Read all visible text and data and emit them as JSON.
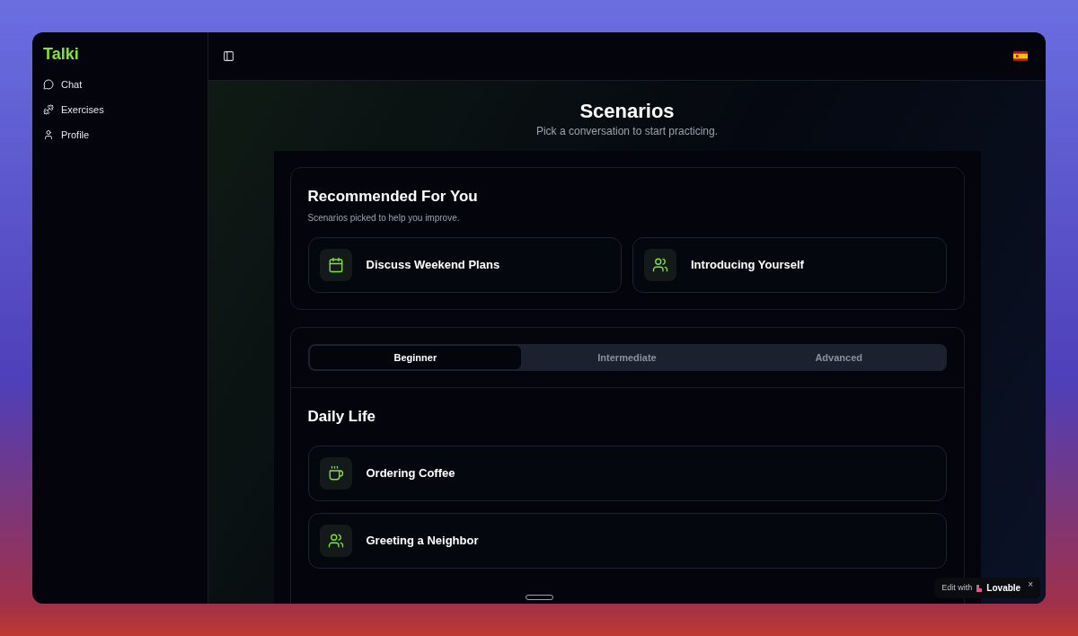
{
  "sidebar": {
    "brand": "Talki",
    "items": [
      {
        "label": "Chat",
        "kind": "chat"
      },
      {
        "label": "Exercises",
        "kind": "exercises"
      },
      {
        "label": "Profile",
        "kind": "profile"
      }
    ]
  },
  "page": {
    "title": "Scenarios",
    "subtitle": "Pick a conversation to start practicing."
  },
  "recommended": {
    "title": "Recommended For You",
    "subtitle": "Scenarios picked to help you improve.",
    "items": [
      {
        "title": "Discuss Weekend Plans",
        "kind": "calendar"
      },
      {
        "title": "Introducing Yourself",
        "kind": "users"
      }
    ]
  },
  "levels": {
    "tabs": [
      {
        "label": "Beginner",
        "selected": true
      },
      {
        "label": "Intermediate",
        "selected": false
      },
      {
        "label": "Advanced",
        "selected": false
      }
    ],
    "section": {
      "title": "Daily Life",
      "items": [
        {
          "title": "Ordering Coffee",
          "kind": "coffee"
        },
        {
          "title": "Greeting a Neighbor",
          "kind": "users"
        }
      ]
    }
  },
  "badge": {
    "prefix": "Edit with",
    "brand": "Lovable",
    "close": "×"
  }
}
